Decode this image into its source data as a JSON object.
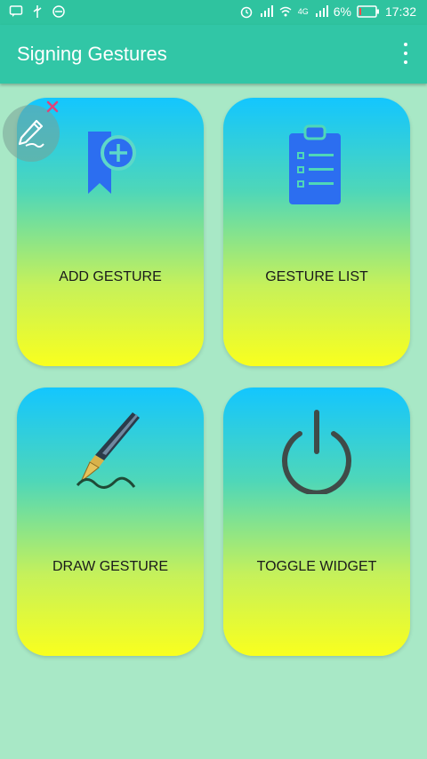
{
  "status_bar": {
    "battery": "6%",
    "time": "17:32",
    "network": "4G"
  },
  "app_bar": {
    "title": "Signing Gestures",
    "menu_icon": "more-vert-icon"
  },
  "cards": [
    {
      "label": "ADD GESTURE",
      "icon": "bookmark-add-icon"
    },
    {
      "label": "GESTURE LIST",
      "icon": "clipboard-list-icon"
    },
    {
      "label": "DRAW GESTURE",
      "icon": "fountain-pen-icon"
    },
    {
      "label": "TOGGLE WIDGET",
      "icon": "power-icon"
    }
  ],
  "floating_widget": {
    "icon": "pen-signature-icon",
    "close_icon": "close-icon"
  },
  "colors": {
    "background": "#a8e8c6",
    "app_bar": "#31c6a6",
    "card_top": "#13c6ff",
    "card_bottom": "#f9ff1e",
    "icon_blue": "#2c6ef0",
    "power_icon": "#3f4b48"
  }
}
